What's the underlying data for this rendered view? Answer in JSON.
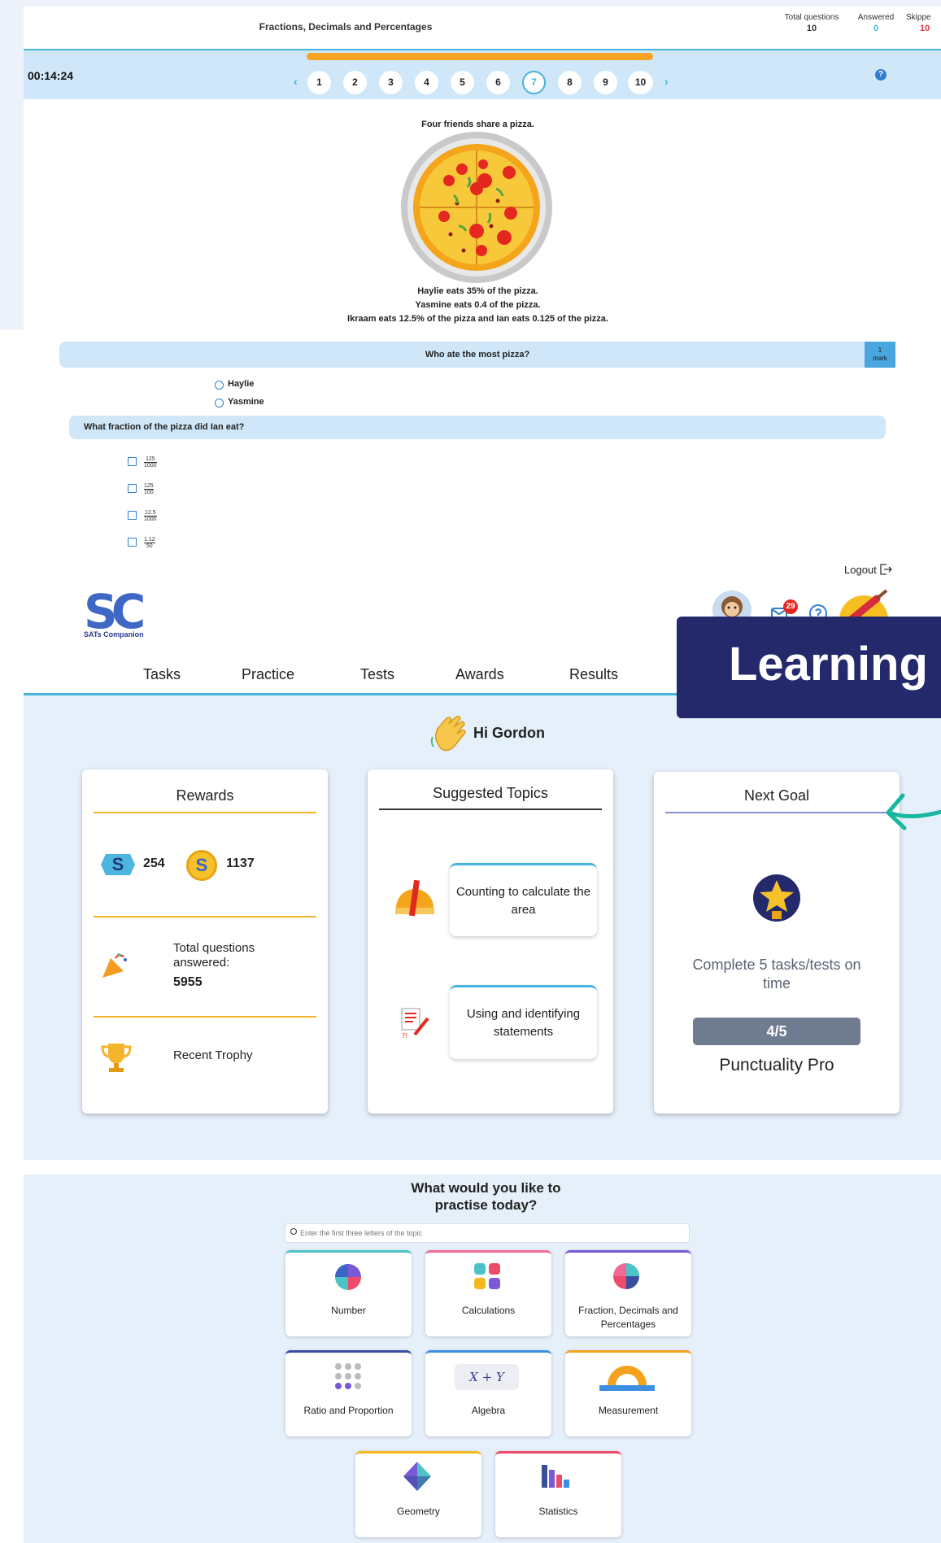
{
  "quiz": {
    "title": "Fractions, Decimals and Percentages",
    "stats": [
      {
        "label": "Total questions",
        "value": "10"
      },
      {
        "label": "Answered",
        "value": "0"
      },
      {
        "label": "Skippe",
        "value": "10"
      }
    ],
    "timer": "00:14:24",
    "prev_arrow": "‹",
    "next_arrow": "›",
    "question_numbers": [
      "1",
      "2",
      "3",
      "4",
      "5",
      "6",
      "7",
      "8",
      "9",
      "10"
    ],
    "current_question": "7",
    "help_glyph": "?",
    "intro": "Four friends share a pizza.",
    "lines": [
      "Haylie eats 35% of the pizza.",
      "Yasmine eats 0.4 of the pizza.",
      "Ikraam eats 12.5% of the pizza and Ian eats 0.125 of the pizza."
    ],
    "part1": {
      "question": "Who ate the most pizza?",
      "mark_num": "1",
      "mark_label": "mark",
      "options": [
        "Haylie",
        "Yasmine"
      ]
    },
    "part2": {
      "question": "What fraction of the pizza did Ian eat?",
      "options": [
        {
          "num": "125",
          "den": "1000"
        },
        {
          "num": "125",
          "den": "100"
        },
        {
          "num": "12.5",
          "den": "1000"
        },
        {
          "num": "1.12",
          "den": "50"
        }
      ]
    }
  },
  "dashboard": {
    "logout": "Logout",
    "logo_text": "SC",
    "logo_caption": "SATs Companion",
    "notification_count": "29",
    "nav": [
      "Tasks",
      "Practice",
      "Tests",
      "Awards",
      "Results"
    ],
    "banner": "Learning",
    "greeting": "Hi Gordon",
    "rewards": {
      "title": "Rewards",
      "gems": "254",
      "coins": "1137",
      "gem_glyph": "S",
      "coin_glyph": "S",
      "total_label": "Total questions answered:",
      "total_value": "5955",
      "trophy_label": "Recent Trophy"
    },
    "suggested": {
      "title": "Suggested Topics",
      "topics": [
        "Counting to calculate the area",
        "Using and identifying statements"
      ]
    },
    "goal": {
      "title": "Next Goal",
      "description": "Complete 5 tasks/tests on time",
      "progress_text": "4/5",
      "progress_fraction": 0.8,
      "name": "Punctuality Pro"
    }
  },
  "practice": {
    "title": "What would you like to practise today?",
    "search_placeholder": "Enter the first three letters of the topic",
    "tiles": [
      {
        "label": "Number",
        "color": "#4cc3c6"
      },
      {
        "label": "Calculations",
        "color": "#f06a96"
      },
      {
        "label": "Fraction, Decimals and Percentages",
        "color": "#7a58d6"
      },
      {
        "label": "Ratio and Proportion",
        "color": "#3a4ea0"
      },
      {
        "label": "Algebra",
        "color": "#3c8fe0"
      },
      {
        "label": "Measurement",
        "color": "#f4a21e"
      },
      {
        "label": "Geometry",
        "color": "#f3b81c"
      },
      {
        "label": "Statistics",
        "color": "#ee4b6a"
      }
    ],
    "algebra_glyph": "X + Y"
  },
  "colors": {
    "accent": "#46b4dc",
    "progress": "#f6a321",
    "banner": "#23296b",
    "answered": "#46b4dc",
    "skipped": "#d93636"
  }
}
